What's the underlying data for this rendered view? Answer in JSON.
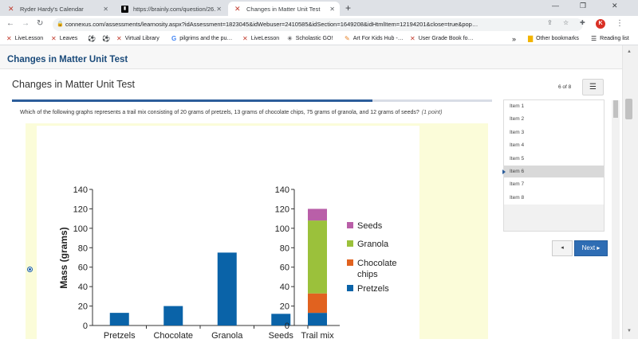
{
  "browser": {
    "tabs": [
      {
        "title": "Ryder Hardy's Calendar",
        "active": false,
        "favicon": "x-logo-icon"
      },
      {
        "title": "https://brainly.com/question/26…",
        "active": false,
        "favicon": "brainly-icon"
      },
      {
        "title": "Changes in Matter Unit Test",
        "active": true,
        "favicon": "x-logo-icon"
      }
    ],
    "new_tab_label": "+",
    "url": "connexus.com/assessments/learnosity.aspx?idAssessment=1823045&idWebuser=2410585&idSection=1649208&idHtmlItem=12194201&close=true&pop…",
    "profile_initial": "K",
    "bookmarks": [
      {
        "label": "LiveLesson",
        "icon": "x-logo-icon"
      },
      {
        "label": "Leaves",
        "icon": "x-logo-icon"
      },
      {
        "label": "",
        "icon": "soccer-ball-icon"
      },
      {
        "label": "",
        "icon": "soccer-ball-icon"
      },
      {
        "label": "Virtual Library",
        "icon": "x-logo-icon"
      },
      {
        "label": "pilgrims and the pu…",
        "icon": "google-icon"
      },
      {
        "label": "LiveLesson",
        "icon": "x-logo-icon"
      },
      {
        "label": "Scholastic GO!",
        "icon": "scholastic-icon"
      },
      {
        "label": "Art For Kids Hub -…",
        "icon": "art-icon"
      },
      {
        "label": "User Grade Book fo…",
        "icon": "x-logo-icon"
      }
    ],
    "bookmarks_more": "»",
    "other_bookmarks": "Other bookmarks",
    "reading_list": "Reading list"
  },
  "page": {
    "header_title": "Changes in Matter Unit Test",
    "test_title": "Changes in Matter Unit Test",
    "counter": "6 of 8",
    "progress_fraction": 0.75,
    "question": "Which of the following graphs represents a trail mix consisting of 20 grams of pretzels, 13 grams of chocolate chips, 75 grams of granola, and 12 grams of seeds?",
    "points": "(1 point)",
    "items": [
      "Item 1",
      "Item 2",
      "Item 3",
      "Item 4",
      "Item 5",
      "Item 6",
      "Item 7",
      "Item 8"
    ],
    "current_item_index": 5,
    "prev_label": "◂",
    "next_label": "Next ▸"
  },
  "chart_data": [
    {
      "type": "bar",
      "ylabel": "Mass (grams)",
      "ylim": [
        0,
        140
      ],
      "yticks": [
        "0",
        "20",
        "40",
        "60",
        "80",
        "100",
        "120",
        "140"
      ],
      "categories": [
        "Pretzels",
        "Chocolate",
        "Granola",
        "Seeds"
      ],
      "values": [
        13,
        20,
        75,
        12
      ],
      "color": "#0a63a8"
    },
    {
      "type": "bar",
      "stacked": true,
      "ylim": [
        0,
        140
      ],
      "yticks": [
        "0",
        "20",
        "40",
        "60",
        "80",
        "100",
        "120",
        "140"
      ],
      "categories": [
        "Trail mix"
      ],
      "series": [
        {
          "name": "Pretzels",
          "values": [
            13
          ],
          "color": "#0a63a8"
        },
        {
          "name": "Chocolate chips",
          "values": [
            20
          ],
          "color": "#e1621f"
        },
        {
          "name": "Granola",
          "values": [
            75
          ],
          "color": "#9bc13b"
        },
        {
          "name": "Seeds",
          "values": [
            12
          ],
          "color": "#b95fa8"
        }
      ],
      "legend": [
        {
          "name": "Seeds",
          "color": "#b95fa8"
        },
        {
          "name": "Granola",
          "color": "#9bc13b"
        },
        {
          "name": "Chocolate chips",
          "color": "#e1621f"
        },
        {
          "name": "Pretzels",
          "color": "#0a63a8"
        }
      ]
    }
  ]
}
